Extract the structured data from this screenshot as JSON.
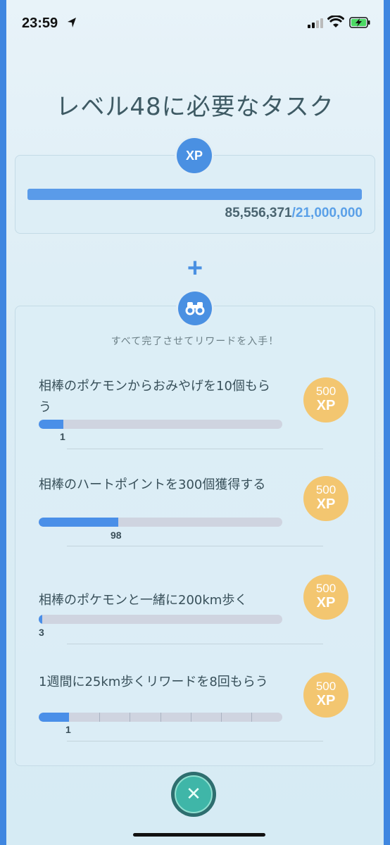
{
  "status_bar": {
    "time": "23:59"
  },
  "title": "レベル48に必要なタスク",
  "xp": {
    "badge": "XP",
    "current": "85,556,371",
    "target": "/21,000,000",
    "progress": 1.0
  },
  "plus": "+",
  "tasks_header": "すべて完了させてリワードを入手！",
  "tasks": [
    {
      "label": "相棒のポケモンからおみやげを10個もらう",
      "count": "1",
      "progress": 0.1,
      "reward_amount": "500",
      "reward_unit": "XP"
    },
    {
      "label": "相棒のハートポイントを300個獲得する",
      "count": "98",
      "progress": 0.327,
      "reward_amount": "500",
      "reward_unit": "XP"
    },
    {
      "label": "相棒のポケモンと一緒に200km歩く",
      "count": "3",
      "progress": 0.015,
      "reward_amount": "500",
      "reward_unit": "XP"
    },
    {
      "label": "1週間に25km歩くリワードを8回もらう",
      "count": "1",
      "progress": 0.125,
      "reward_amount": "500",
      "reward_unit": "XP"
    }
  ],
  "colors": {
    "accent": "#4a90e2",
    "reward": "#f3c670",
    "close": "#3fb6a8"
  }
}
